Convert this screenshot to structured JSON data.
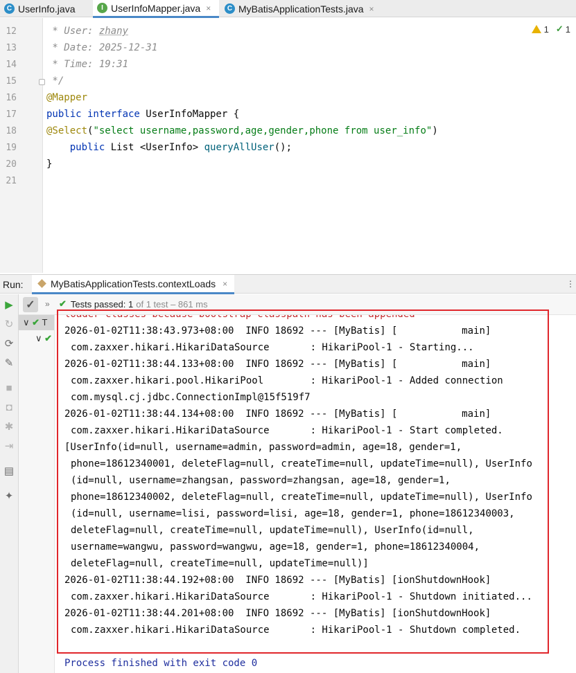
{
  "tabs": [
    {
      "icon": "C",
      "icon_name": "class-file-icon",
      "label": "UserInfo.java",
      "active": false
    },
    {
      "icon": "I",
      "icon_name": "interface-file-icon",
      "label": "UserInfoMapper.java",
      "active": true
    },
    {
      "icon": "C",
      "icon_name": "test-class-file-icon",
      "label": "MyBatisApplicationTests.java",
      "active": false
    }
  ],
  "tab_close_glyph": "×",
  "inspections": {
    "warnings": "1",
    "checks": "1"
  },
  "editor": {
    "line_numbers": [
      "12",
      "13",
      "14",
      "15",
      "16",
      "17",
      "18",
      "19",
      "20",
      "21"
    ],
    "line12_prefix": " * User: ",
    "line12_user": "zhany",
    "line13": " * Date: 2025-12-31",
    "line14": " * Time: 19:31",
    "line15": " */",
    "line16": "@Mapper",
    "line17_kw": "public interface",
    "line17_rest": " UserInfoMapper {",
    "line18_ann": "@Select",
    "line18_open": "(",
    "line18_str": "\"select username,password,age,gender,phone from user_info\"",
    "line18_close": ")",
    "line19_kw": "    public",
    "line19_mid": " List <UserInfo> ",
    "line19_meth": "queryAllUser",
    "line19_end": "();",
    "line20": "}"
  },
  "run": {
    "label": "Run:",
    "tab_label": "MyBatisApplicationTests.contextLoads",
    "more": "⋮",
    "tests_passed": "Tests passed: 1",
    "tests_meta": "of 1 test – 861 ms",
    "tree_root": "T",
    "chevron": "»"
  },
  "console": {
    "lines": [
      {
        "text": "loader classes because bootstrap classpath has been appended",
        "style": "red"
      },
      {
        "text": "2026-01-02T11:38:43.973+08:00  INFO 18692 --- [MyBatis] [           main]",
        "style": ""
      },
      {
        "text": "com.zaxxer.hikari.HikariDataSource       : HikariPool-1 - Starting...",
        "style": "ind"
      },
      {
        "text": "2026-01-02T11:38:44.133+08:00  INFO 18692 --- [MyBatis] [           main]",
        "style": ""
      },
      {
        "text": "com.zaxxer.hikari.pool.HikariPool        : HikariPool-1 - Added connection",
        "style": "ind"
      },
      {
        "text": "com.mysql.cj.jdbc.ConnectionImpl@15f519f7",
        "style": "ind"
      },
      {
        "text": "2026-01-02T11:38:44.134+08:00  INFO 18692 --- [MyBatis] [           main]",
        "style": ""
      },
      {
        "text": "com.zaxxer.hikari.HikariDataSource       : HikariPool-1 - Start completed.",
        "style": "ind"
      },
      {
        "text": "[UserInfo(id=null, username=admin, password=admin, age=18, gender=1,",
        "style": ""
      },
      {
        "text": "phone=18612340001, deleteFlag=null, createTime=null, updateTime=null), UserInfo",
        "style": "ind"
      },
      {
        "text": "(id=null, username=zhangsan, password=zhangsan, age=18, gender=1,",
        "style": "ind"
      },
      {
        "text": "phone=18612340002, deleteFlag=null, createTime=null, updateTime=null), UserInfo",
        "style": "ind"
      },
      {
        "text": "(id=null, username=lisi, password=lisi, age=18, gender=1, phone=18612340003,",
        "style": "ind"
      },
      {
        "text": "deleteFlag=null, createTime=null, updateTime=null), UserInfo(id=null,",
        "style": "ind"
      },
      {
        "text": "username=wangwu, password=wangwu, age=18, gender=1, phone=18612340004,",
        "style": "ind"
      },
      {
        "text": "deleteFlag=null, createTime=null, updateTime=null)]",
        "style": "ind"
      },
      {
        "text": "2026-01-02T11:38:44.192+08:00  INFO 18692 --- [MyBatis] [ionShutdownHook]",
        "style": ""
      },
      {
        "text": "com.zaxxer.hikari.HikariDataSource       : HikariPool-1 - Shutdown initiated...",
        "style": "ind"
      },
      {
        "text": "2026-01-02T11:38:44.201+08:00  INFO 18692 --- [MyBatis] [ionShutdownHook]",
        "style": ""
      },
      {
        "text": "com.zaxxer.hikari.HikariDataSource       : HikariPool-1 - Shutdown completed.",
        "style": "ind"
      },
      {
        "text": "",
        "style": ""
      },
      {
        "text": "Process finished with exit code 0",
        "style": "blue"
      }
    ]
  },
  "colors": {
    "highlight_box": "#e0262b",
    "tab_underline": "#4a88c7",
    "passed_green": "#3aa53a"
  }
}
